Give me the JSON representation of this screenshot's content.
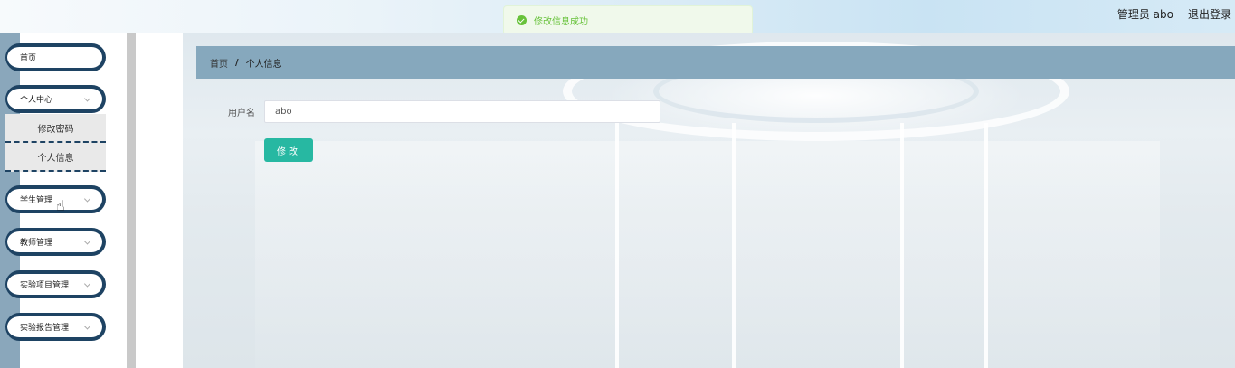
{
  "header": {
    "admin_label": "管理员 abo",
    "logout_label": "退出登录"
  },
  "toast": {
    "message": "修改信息成功",
    "icon": "check-circle-icon"
  },
  "sidebar": {
    "items": [
      {
        "label": "首页",
        "expandable": false
      },
      {
        "label": "个人中心",
        "expandable": true
      },
      {
        "label": "学生管理",
        "expandable": true
      },
      {
        "label": "教师管理",
        "expandable": true
      },
      {
        "label": "实验项目管理",
        "expandable": true
      },
      {
        "label": "实验报告管理",
        "expandable": true
      }
    ],
    "submenu": [
      {
        "label": "修改密码"
      },
      {
        "label": "个人信息"
      }
    ]
  },
  "breadcrumb": {
    "home": "首页",
    "separator": "/",
    "current": "个人信息"
  },
  "form": {
    "username_label": "用户名",
    "username_value": "abo",
    "submit_label": "修改"
  },
  "colors": {
    "sidebar_accent": "#1e4363",
    "breadcrumb_bg": "#86a8bd",
    "button": "#27b8a2",
    "toast_success": "#67c23a"
  }
}
